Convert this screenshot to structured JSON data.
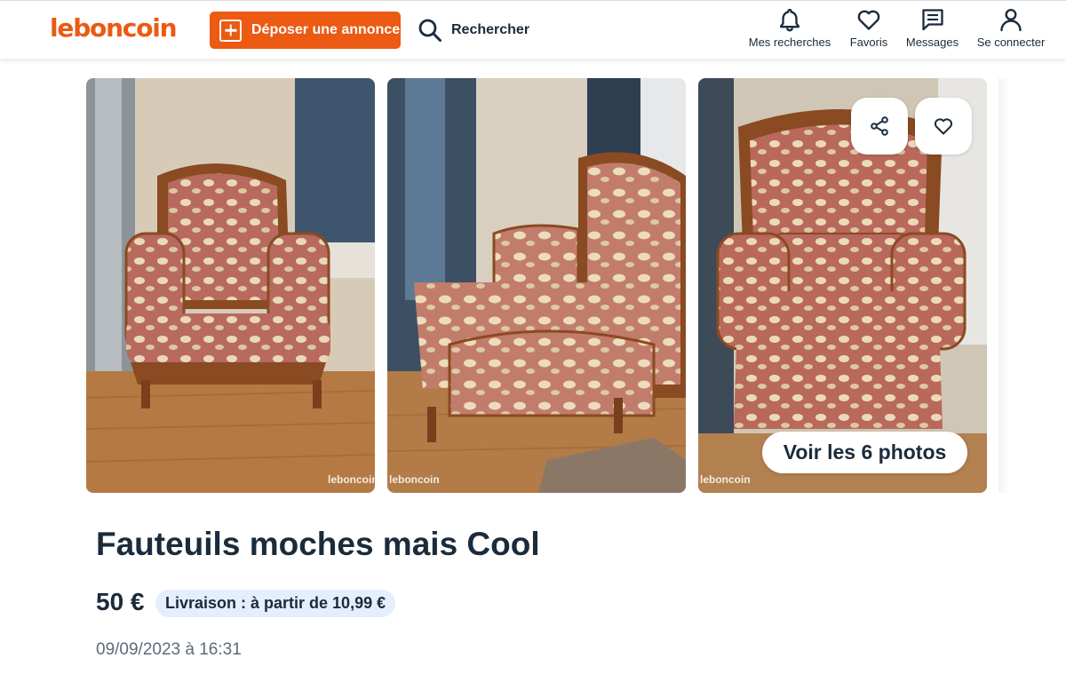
{
  "header": {
    "logo": "leboncoin",
    "deposit_label": "Déposer une annonce",
    "search_label": "Rechercher",
    "nav": [
      {
        "label": "Mes recherches",
        "icon": "bell-icon"
      },
      {
        "label": "Favoris",
        "icon": "heart-icon"
      },
      {
        "label": "Messages",
        "icon": "message-icon"
      },
      {
        "label": "Se connecter",
        "icon": "user-icon"
      }
    ]
  },
  "gallery": {
    "watermark": "leboncoin",
    "all_photos_label": "Voir les 6 photos",
    "share_icon": "share-icon",
    "favorite_icon": "heart-icon"
  },
  "ad": {
    "title": "Fauteuils moches mais Cool",
    "price": "50 €",
    "delivery": "Livraison : à partir de 10,99 €",
    "date": "09/09/2023 à 16:31"
  },
  "colors": {
    "brand": "#ec5a13",
    "text": "#1a2b3c",
    "badge_bg": "#e5eefc"
  }
}
